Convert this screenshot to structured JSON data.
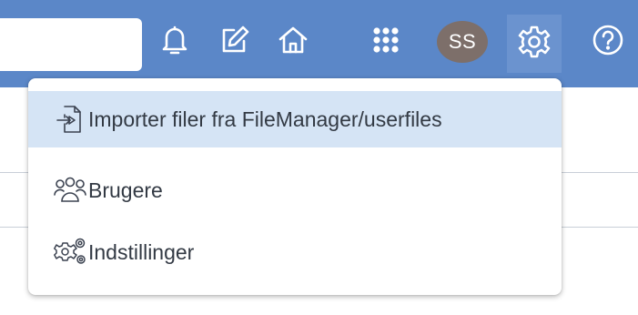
{
  "header": {
    "search": {
      "value": "",
      "placeholder": ""
    },
    "avatar_initials": "SS",
    "icons": [
      "bell-icon",
      "edit-icon",
      "home-icon",
      "apps-grid-icon",
      "gear-icon",
      "help-icon"
    ],
    "colors": {
      "bar": "#5b87c8",
      "avatar": "#7d6f6a",
      "highlight": "#d5e4f5"
    }
  },
  "dropdown": {
    "items": [
      {
        "label": "Importer filer fra FileManager/userfiles",
        "icon": "file-import-icon"
      },
      {
        "label": "Brugere",
        "icon": "users-icon"
      },
      {
        "label": "Indstillinger",
        "icon": "gears-icon"
      }
    ]
  }
}
